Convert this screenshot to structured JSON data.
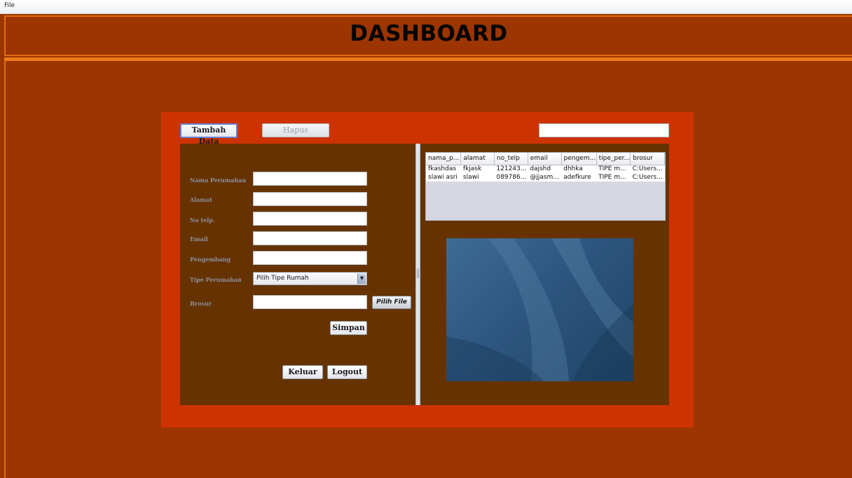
{
  "menu": {
    "file": "File"
  },
  "header": {
    "title": "DASHBOARD"
  },
  "toolbar": {
    "add_label": "Tambah Data",
    "delete_label": "Hapus",
    "search_value": ""
  },
  "form": {
    "nama_label": "Nama Perumahan",
    "alamat_label": "Alamat",
    "telp_label": "No telp.",
    "email_label": "Email",
    "pengembang_label": "Pengembang",
    "tipe_label": "Tipe Perumahan",
    "tipe_selected": "Pilih Tipe Rumah",
    "brosur_label": "Brosur",
    "pilih_file_label": "Pilih File",
    "simpan_label": "Simpan",
    "keluar_label": "Keluar",
    "logout_label": "Logout"
  },
  "table": {
    "columns": [
      "nama_p...",
      "alamat",
      "no_telp",
      "email",
      "pengem...",
      "tipe_per...",
      "brosur"
    ],
    "rows": [
      [
        "fkashdas",
        "fkjask",
        "121243...",
        "dajshd",
        "dhhka",
        "TIPE m...",
        "C:Users..."
      ],
      [
        "slawi asri",
        "slawi",
        "089786...",
        "@jjasm...",
        "adefkure",
        "TIPE m...",
        "C:Users..."
      ]
    ]
  },
  "icons": {
    "dropdown": "chevron-down-icon",
    "split_grip": "grip-icon"
  },
  "colors": {
    "background": "#9c3500",
    "panel": "#cc3300",
    "pane": "#663300",
    "accent_line": "#f07a1e"
  }
}
